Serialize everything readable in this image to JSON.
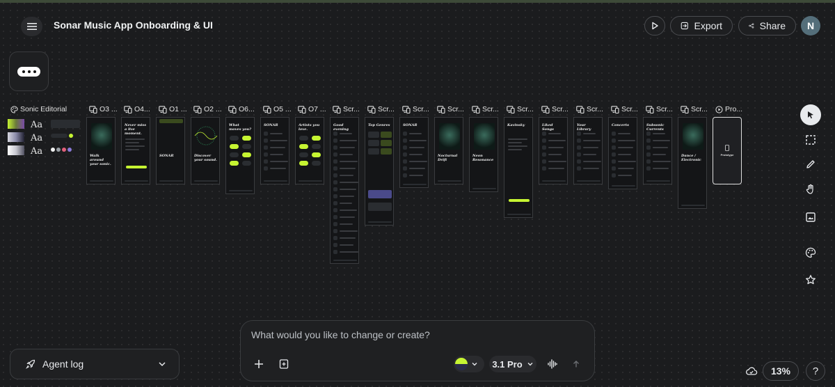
{
  "header": {
    "title": "Sonar Music App Onboarding & UI",
    "export_label": "Export",
    "share_label": "Share",
    "avatar_initial": "N"
  },
  "design_system": {
    "label": "Sonic Editorial",
    "type_samples": [
      "Aa",
      "Aa",
      "Aa"
    ]
  },
  "frames": [
    {
      "label": "O3 ...",
      "heading": "Walk around your sonic."
    },
    {
      "label": "O4...",
      "heading": "Never miss a live moment."
    },
    {
      "label": "O1 ...",
      "heading": "SONAR"
    },
    {
      "label": "O2 ...",
      "heading": "Discover your sound."
    },
    {
      "label": "O6...",
      "heading": "What moves you?"
    },
    {
      "label": "O5 ...",
      "heading": "SONAR"
    },
    {
      "label": "O7 ...",
      "heading": "Artists you love."
    },
    {
      "label": "Scr...",
      "heading": "Good evening"
    },
    {
      "label": "Scr...",
      "heading": "Top Genres"
    },
    {
      "label": "Scr...",
      "heading": "SONAR"
    },
    {
      "label": "Scr...",
      "heading": "Nocturnal Drift"
    },
    {
      "label": "Scr...",
      "heading": "Neon Resonance"
    },
    {
      "label": "Scr...",
      "heading": "Kavinsky"
    },
    {
      "label": "Scr...",
      "heading": "Liked Songs"
    },
    {
      "label": "Scr...",
      "heading": "Your Library"
    },
    {
      "label": "Scr...",
      "heading": "Concerts"
    },
    {
      "label": "Scr...",
      "heading": "Subsonic Currents"
    },
    {
      "label": "Scr...",
      "heading": "Dance / Electronic"
    },
    {
      "label": "Pro...",
      "heading": "Prototype"
    }
  ],
  "composer": {
    "placeholder": "What would you like to change or create?",
    "model_label": "3.1 Pro"
  },
  "agent_log": {
    "label": "Agent log"
  },
  "zoom": {
    "value": "13%"
  },
  "colors": {
    "accent": "#c6f432",
    "canvas": "#1b1c1e",
    "frame_bg": "#141517"
  }
}
